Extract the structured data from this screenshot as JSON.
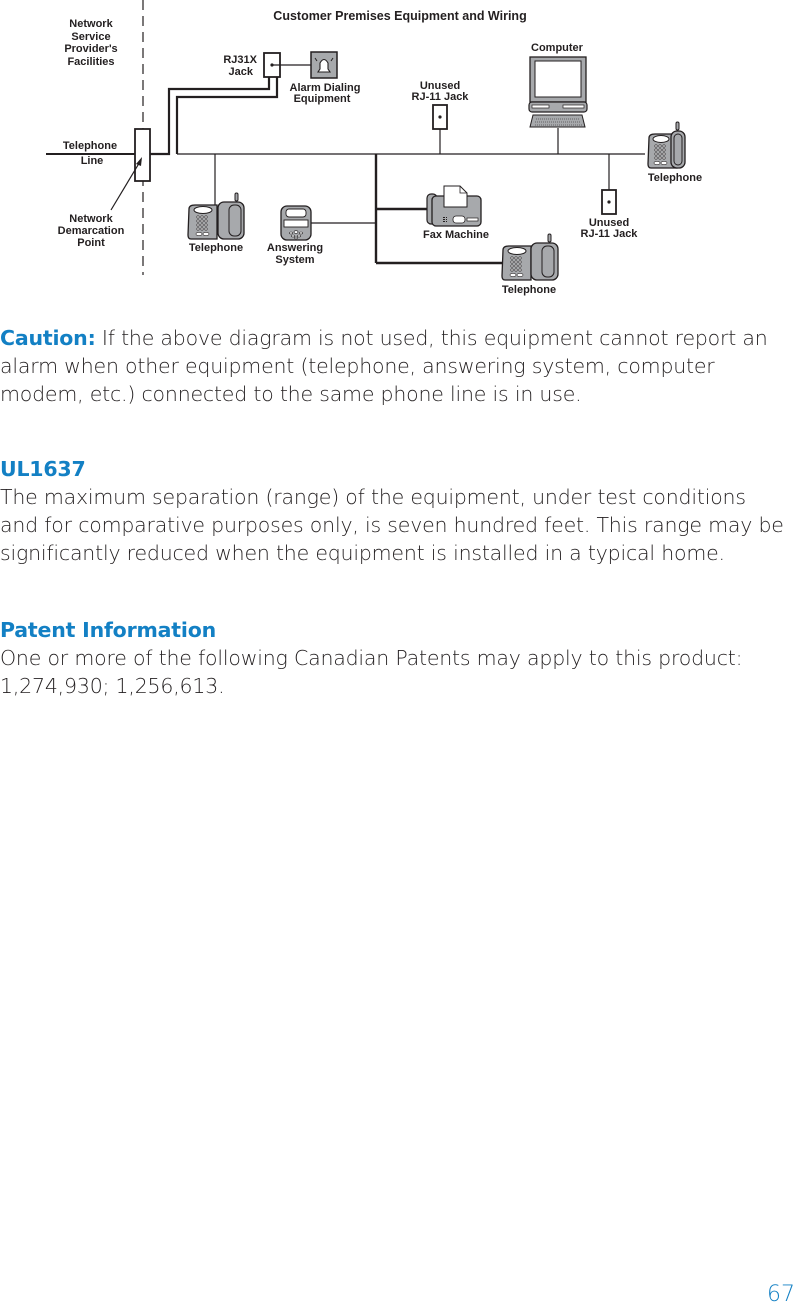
{
  "diagram": {
    "title": "Customer Premises Equipment and Wiring",
    "labels": {
      "network_service": [
        "Network",
        "Service",
        "Provider's",
        "Facilities"
      ],
      "telephone_line": [
        "Telephone",
        "Line"
      ],
      "network_demarcation": [
        "Network",
        "Demarcation",
        "Point"
      ],
      "rj31x_jack": [
        "RJ31X",
        "Jack"
      ],
      "alarm_dialing": [
        "Alarm Dialing",
        "Equipment"
      ],
      "unused_jack_top": [
        "Unused",
        "RJ-11 Jack"
      ],
      "computer": "Computer",
      "telephone_right": "Telephone",
      "telephone_left": "Telephone",
      "answering_system": [
        "Answering",
        "System"
      ],
      "fax_machine": "Fax Machine",
      "unused_jack_bottom": [
        "Unused",
        "RJ-11 Jack"
      ],
      "telephone_bottom": "Telephone"
    }
  },
  "caution": {
    "heading": "Caution:",
    "text": " If the above diagram is not used, this equipment cannot report an alarm when other equipment (telephone, answering system, computer modem, etc.) connected to the same phone line is in use."
  },
  "ul1637": {
    "heading": "UL1637",
    "lines": [
      "The maximum separation (range) of the equipment, under test conditions",
      "and for comparative purposes only, is seven hundred feet.  This range may be",
      "significantly reduced when the equipment is installed in a typical home."
    ]
  },
  "patent": {
    "heading": "Patent Information",
    "lines": [
      "One or more of the following Canadian Patents may apply to this product:",
      "1,274,930; 1,256,613."
    ]
  },
  "page_number": "67",
  "colors": {
    "heading_blue": "#1380c4",
    "body_text": "#231f20",
    "device_gray": "#a7a9ac"
  }
}
